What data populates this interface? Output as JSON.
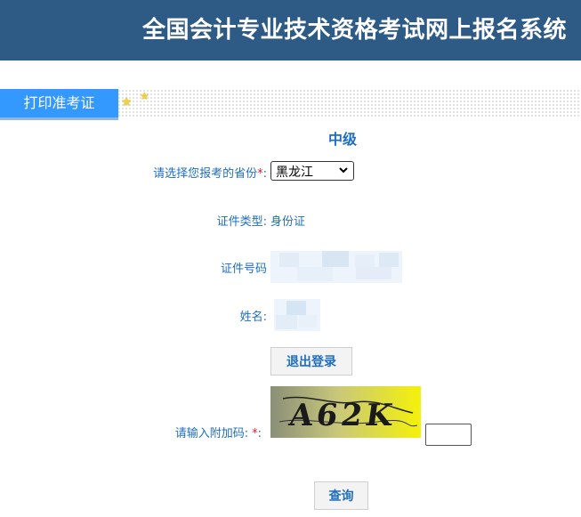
{
  "header": {
    "title": "全国会计专业技术资格考试网上报名系统"
  },
  "tab": {
    "label": "打印准考证"
  },
  "level": {
    "title": "中级"
  },
  "form": {
    "province_label": "请选择您报考的省份",
    "province_required": "*",
    "province_colon": ":",
    "province_value": "黑龙江",
    "id_type_label": "证件类型:",
    "id_type_value": "身份证",
    "id_number_label": "证件号码",
    "name_label": "姓名:",
    "logout_label": "退出登录",
    "captcha_label": "请输入附加码:",
    "captcha_required": "*",
    "captcha_colon": ":",
    "captcha_text": "A62K",
    "query_label": "查询"
  },
  "colors": {
    "header_bg": "#2d5b86",
    "accent": "#1f6ec0",
    "tab_bg": "#3399ff",
    "required": "#e02020"
  },
  "icons": [
    "star-icon",
    "chevron-down-icon"
  ]
}
